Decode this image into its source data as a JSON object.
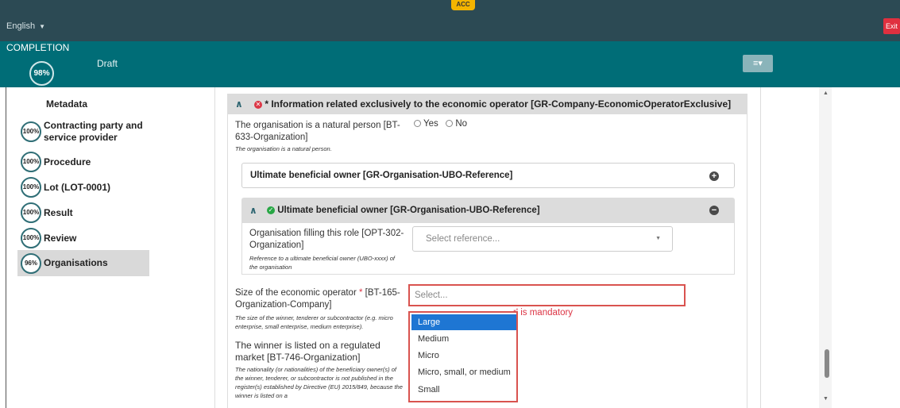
{
  "topbar": {
    "language": "English",
    "language_caret": "▼",
    "env_badge": "ACC",
    "exit_label": "Exit",
    "bg_color": "#2c4a54"
  },
  "completion": {
    "title": "COMPLETION",
    "percent": "98%",
    "status": "Draft",
    "settings_icon": "≡▾",
    "band_color": "#006d77"
  },
  "sidebar": {
    "metadata_label": "Metadata",
    "items": [
      {
        "percent": "100%",
        "label": "Contracting party and service provider"
      },
      {
        "percent": "100%",
        "label": "Procedure"
      },
      {
        "percent": "100%",
        "label": "Lot (LOT-0001)"
      },
      {
        "percent": "100%",
        "label": "Result"
      },
      {
        "percent": "100%",
        "label": "Review"
      },
      {
        "percent": "96%",
        "label": "Organisations",
        "active": true
      }
    ]
  },
  "main": {
    "panel_title": "* Information related exclusively to the economic operator  [GR-Company-EconomicOperatorExclusive]",
    "panel_error_icon": "✕",
    "chevron_up": "∧",
    "natural_person": {
      "label": "The organisation is a natural person [BT-633-Organization]",
      "help": "The organisation is a natural person.",
      "options": [
        "Yes",
        "No"
      ]
    },
    "ubo_collapsed": {
      "title": "Ultimate beneficial owner  [GR-Organisation-UBO-Reference]",
      "add_icon": "+"
    },
    "ubo_expanded": {
      "title": "Ultimate beneficial owner  [GR-Organisation-UBO-Reference]",
      "ok_icon": "✓",
      "remove_icon": "−",
      "role_label": "Organisation filling this role [OPT-302-Organization]",
      "role_help": "Reference to a ultimate beneficial owner (UBO-xxxx) of the organisation",
      "select_placeholder": "Select reference...",
      "dropdown_caret": "▼"
    },
    "size": {
      "label_prefix": "Size of the economic operator ",
      "required_mark": "*",
      "label_suffix": " [BT-165-Organization-Company]",
      "help": "The size of the winner, tenderer or subcontractor (e.g. micro enterprise, small enterprise, medium enterprise).",
      "input_placeholder": "Select...",
      "error_text": "r' is mandatory",
      "options": [
        "Large",
        "Medium",
        "Micro",
        "Micro, small, or medium",
        "Small"
      ],
      "selected_option": "Large"
    },
    "regulated_market": {
      "label": "The winner is listed on a regulated market [BT-746-Organization]",
      "help": "The nationality (or nationalities) of the beneficiary owner(s) of the winner, tenderer, or subcontractor is not published in the register(s) established by Directive (EU) 2015/849, because the winner is listed on a"
    }
  },
  "scrollbar": {
    "up_arrow": "▲",
    "down_arrow": "▼"
  },
  "colors": {
    "accent": "#006d77",
    "error": "#dc3545",
    "selected": "#1e76d3",
    "success": "#28a745"
  }
}
